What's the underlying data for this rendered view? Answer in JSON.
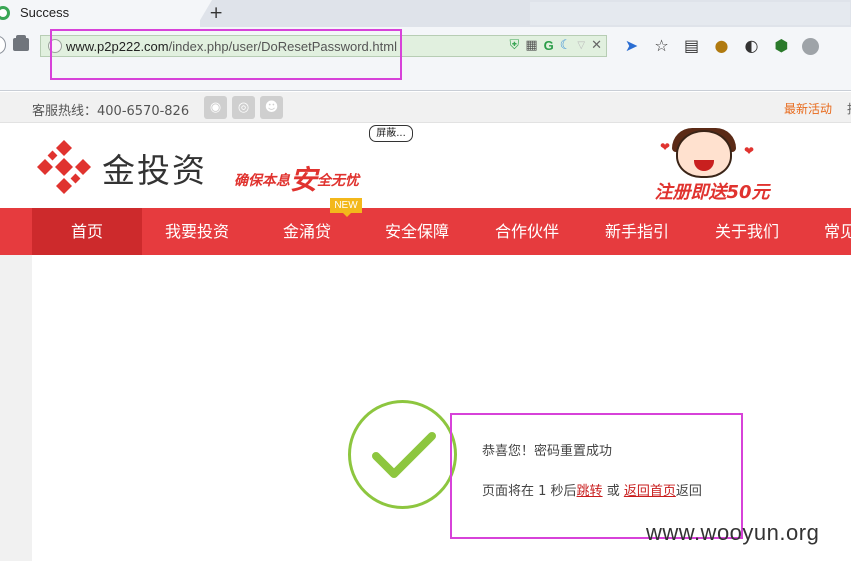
{
  "browser": {
    "tab_title": "Success",
    "new_tab_label": "+",
    "url_host": "www.p2p222.com",
    "url_path": "/index.php/user/DoResetPassword.html",
    "address_icons": [
      "shield-check-icon",
      "qr-code-icon",
      "g-icon",
      "moon-icon",
      "dropdown-icon",
      "close-icon"
    ],
    "extension_icons": [
      "bird-icon",
      "star-icon",
      "reader-icon",
      "coin-icon",
      "palette-icon",
      "shield-icon",
      "avatar-icon"
    ]
  },
  "topbar": {
    "hotline": "客服热线：400-6570-826",
    "social_icons": [
      "wechat-icon",
      "weibo-icon",
      "user-group-icon"
    ],
    "latest_activity": "最新活动",
    "cut_text": "报"
  },
  "header": {
    "logo_text": "金投资",
    "slogan_part1": "确保本息",
    "slogan_big": "安",
    "slogan_part2": "全无忧",
    "screen_button": "屏蔽...",
    "promo_text": "注册即送50元"
  },
  "nav": {
    "items": [
      {
        "label": "首页",
        "active": true
      },
      {
        "label": "我要投资",
        "active": false
      },
      {
        "label": "金涌贷",
        "active": false
      },
      {
        "label": "安全保障",
        "active": false
      },
      {
        "label": "合作伙伴",
        "active": false
      },
      {
        "label": "新手指引",
        "active": false
      },
      {
        "label": "关于我们",
        "active": false
      },
      {
        "label": "常见",
        "active": false
      }
    ],
    "badge": "NEW"
  },
  "content": {
    "success_message": "恭喜您！密码重置成功",
    "redirect_prefix": "页面将在 1 秒后",
    "redirect_link": "跳转",
    "redirect_or": " 或 ",
    "home_link": "返回首页",
    "redirect_suffix": "返回"
  },
  "watermark": "www.wooyun.org",
  "colors": {
    "nav_red": "#e63b3e",
    "nav_active": "#cd2a2c",
    "success_green": "#8dc63f",
    "annotation_magenta": "#d742d9",
    "link_red": "#c81c1c"
  }
}
